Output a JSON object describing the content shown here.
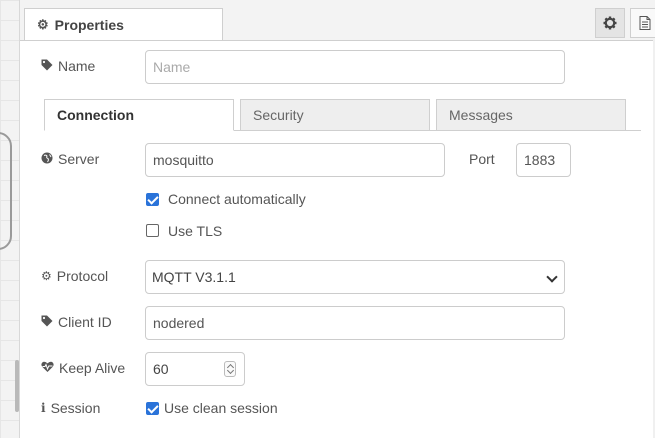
{
  "tray": {
    "tab_label": "Properties",
    "tab_icon": "gear-icon",
    "buttons": [
      {
        "icon": "gear-icon"
      },
      {
        "icon": "document-icon"
      }
    ]
  },
  "form": {
    "name": {
      "label": "Name",
      "placeholder": "Name",
      "value": "",
      "icon": "tag-icon"
    },
    "tabs": [
      {
        "label": "Connection",
        "active": true
      },
      {
        "label": "Security",
        "active": false
      },
      {
        "label": "Messages",
        "active": false
      }
    ],
    "server": {
      "label": "Server",
      "value": "mosquitto",
      "icon": "globe-icon"
    },
    "port": {
      "label": "Port",
      "value": "1883"
    },
    "connect_automatically": {
      "label": "Connect automatically",
      "checked": true
    },
    "use_tls": {
      "label": "Use TLS",
      "checked": false
    },
    "protocol": {
      "label": "Protocol",
      "value": "MQTT V3.1.1",
      "icon": "gear-icon"
    },
    "client_id": {
      "label": "Client ID",
      "value": "nodered",
      "icon": "tag-icon"
    },
    "keep_alive": {
      "label": "Keep Alive",
      "value": "60",
      "icon": "heartbeat-icon"
    },
    "session": {
      "label": "Session",
      "checkbox_label": "Use clean session",
      "checked": true,
      "icon": "info-icon"
    }
  },
  "colors": {
    "accent": "#2a73d9",
    "border": "#cccccc",
    "header_bg": "#f3f3f3"
  }
}
